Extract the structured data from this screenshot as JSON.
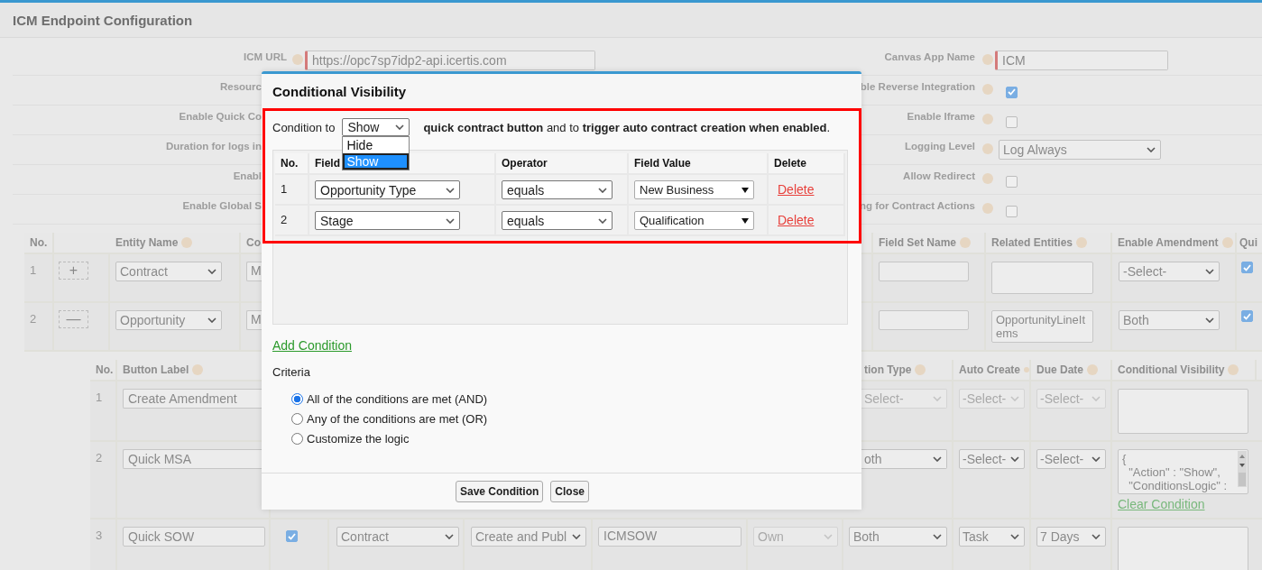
{
  "page": {
    "title": "ICM Endpoint Configuration"
  },
  "form": {
    "left": [
      {
        "label": "ICM URL",
        "help": true,
        "field": {
          "kind": "input",
          "value": "https://opc7sp7idp2-api.icertis.com",
          "required": true
        }
      },
      {
        "label": "Resourc"
      },
      {
        "label": "Enable Quick Co"
      },
      {
        "label": "Duration for logs in"
      },
      {
        "label": "Enabl"
      },
      {
        "label": "Enable Global S"
      }
    ],
    "right": [
      {
        "label": "Canvas App Name",
        "help": true,
        "field": {
          "kind": "input",
          "value": "ICM",
          "required": true
        }
      },
      {
        "label": "ble Reverse Integration",
        "help": true,
        "field": {
          "kind": "checkbox",
          "checked": true
        }
      },
      {
        "label": "Enable Iframe",
        "help": true,
        "field": {
          "kind": "checkbox",
          "checked": false
        }
      },
      {
        "label": "Logging Level",
        "help": true,
        "field": {
          "kind": "select",
          "value": "Log Always"
        }
      },
      {
        "label": "Allow Redirect",
        "help": true,
        "field": {
          "kind": "checkbox",
          "checked": false
        }
      },
      {
        "label": "ng for Contract Actions",
        "help": true,
        "field": {
          "kind": "checkbox",
          "checked": false
        }
      }
    ]
  },
  "entity_table": {
    "columns_left": [
      {
        "label": "No."
      },
      {
        "label": "Entity Name",
        "help": true
      },
      {
        "label": "Co"
      }
    ],
    "columns_right": [
      {
        "label": "Field Set Name",
        "help": true
      },
      {
        "label": "Related Entities",
        "help": true
      },
      {
        "label": "Enable Amendment",
        "help": true
      },
      {
        "label": "Qui"
      }
    ],
    "rows": [
      {
        "left": [
          {
            "kind": "text",
            "value": "1"
          },
          {
            "kind": "button",
            "value": "+"
          },
          {
            "kind": "select",
            "value": "Contract"
          },
          {
            "kind": "input",
            "value": "M"
          }
        ],
        "right": [
          {
            "kind": "input"
          },
          {
            "kind": "textarea"
          },
          {
            "kind": "select",
            "value": "-Select-"
          },
          {
            "kind": "checkbox",
            "checked": true
          }
        ]
      },
      {
        "left": [
          {
            "kind": "text",
            "value": "2"
          },
          {
            "kind": "button",
            "value": "—"
          },
          {
            "kind": "select",
            "value": "Opportunity"
          },
          {
            "kind": "input",
            "value": "M"
          }
        ],
        "right": [
          {
            "kind": "input"
          },
          {
            "kind": "textarea",
            "value": "OpportunityLineItems"
          },
          {
            "kind": "select",
            "value": "Both"
          },
          {
            "kind": "checkbox",
            "checked": true
          }
        ]
      }
    ]
  },
  "button_table": {
    "columns_left": [
      {
        "label": "No."
      },
      {
        "label": "Button Label",
        "help": true
      }
    ],
    "columns_right": [
      {
        "label": "tion Type",
        "help": true
      },
      {
        "label": "Auto Create",
        "help": true
      },
      {
        "label": "Due Date",
        "help": true
      },
      {
        "label": "Conditional Visibility",
        "help": true
      }
    ],
    "rows": [
      {
        "left": [
          {
            "kind": "text",
            "value": "1"
          },
          {
            "kind": "input",
            "value": "Create Amendment"
          }
        ],
        "right": [
          {
            "kind": "select",
            "value": "Select-",
            "disabled": true
          },
          {
            "kind": "select",
            "value": "-Select-",
            "disabled": true
          },
          {
            "kind": "select",
            "value": "-Select-",
            "disabled": true
          },
          {
            "kind": "textarea"
          }
        ]
      },
      {
        "left": [
          {
            "kind": "text",
            "value": "2"
          },
          {
            "kind": "input",
            "value": "Quick MSA"
          }
        ],
        "right": [
          {
            "kind": "select",
            "value": "oth"
          },
          {
            "kind": "select",
            "value": "-Select-"
          },
          {
            "kind": "select",
            "value": "-Select-"
          },
          {
            "kind": "textarea",
            "value": "{\n  \"Action\" : \"Show\",\n  \"ConditionsLogic\" :",
            "link": "Clear Condition"
          }
        ]
      },
      {
        "cells": [
          {
            "kind": "text",
            "value": "3"
          },
          {
            "kind": "input",
            "value": "Quick SOW"
          },
          {
            "kind": "checkbox",
            "checked": true
          },
          {
            "kind": "select",
            "value": "Contract"
          },
          {
            "kind": "select",
            "value": "Create and Publ"
          },
          {
            "kind": "input",
            "value": "ICMSOW"
          },
          {
            "kind": "select",
            "value": "Own",
            "disabled": true
          },
          {
            "kind": "select",
            "value": "Both"
          },
          {
            "kind": "select",
            "value": "Task"
          },
          {
            "kind": "select",
            "value": "7 Days"
          },
          {
            "kind": "textarea"
          }
        ]
      }
    ]
  },
  "dialog": {
    "title": "Conditional Visibility",
    "condition": {
      "prefix": "Condition to",
      "select": {
        "value": "Show",
        "open": true,
        "options": [
          {
            "label": "Hide",
            "selected": false
          },
          {
            "label": "Show",
            "selected": true
          }
        ]
      },
      "text": "**quick contract button** and to **trigger auto contract creation when enabled**."
    },
    "conditions": {
      "columns": [
        "No.",
        "Field",
        "Operator",
        "Field Value",
        "Delete"
      ],
      "rows": [
        {
          "no": "1",
          "field": "Opportunity Type",
          "operator": "equals",
          "value": "New Business",
          "action": "Delete"
        },
        {
          "no": "2",
          "field": "Stage",
          "operator": "equals",
          "value": "Qualification",
          "action": "Delete"
        }
      ]
    },
    "add_link": "Add Condition",
    "criteria": {
      "label": "Criteria",
      "options": [
        {
          "label": "All of the conditions are met (AND)",
          "selected": true
        },
        {
          "label": "Any of the conditions are met (OR)",
          "selected": false
        },
        {
          "label": "Customize the logic",
          "selected": false
        }
      ]
    },
    "buttons": [
      "Save Condition",
      "Close"
    ]
  }
}
